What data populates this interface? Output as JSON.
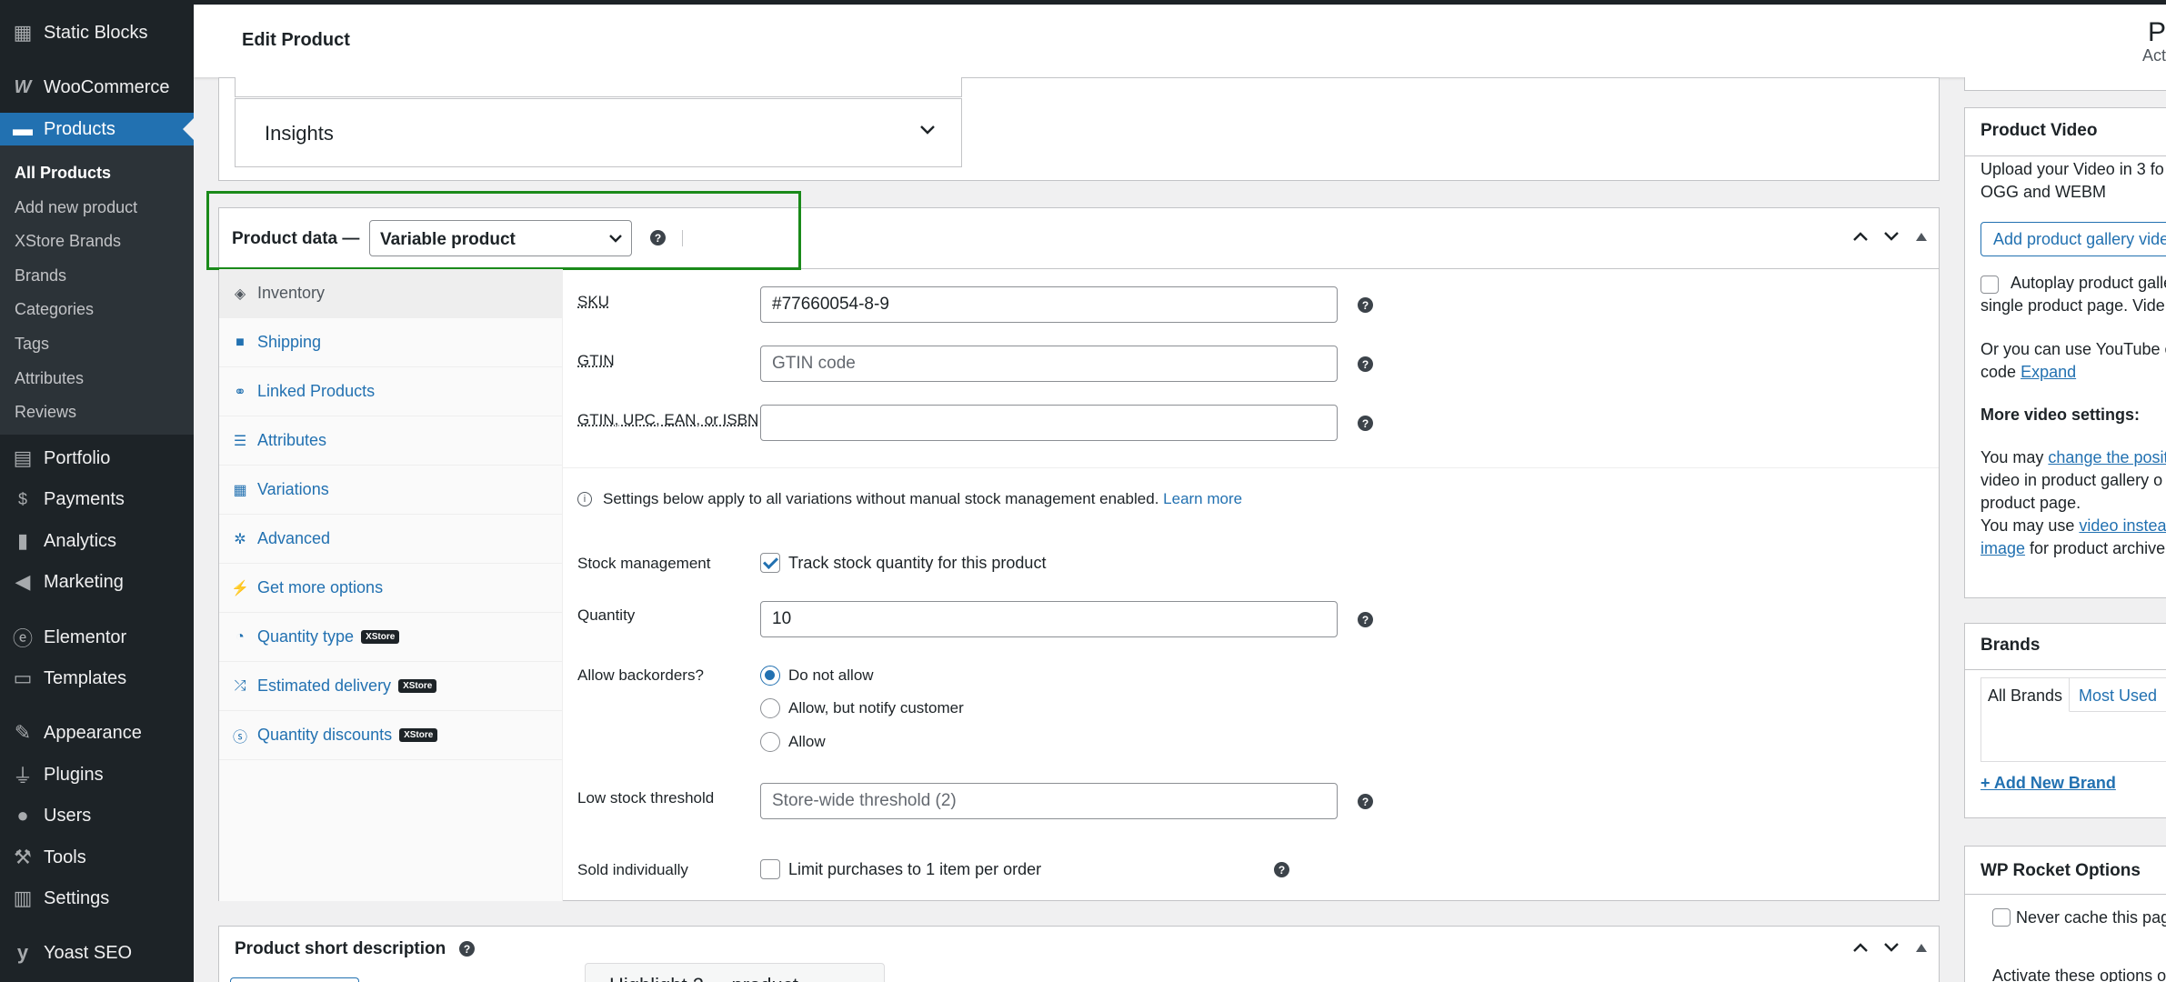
{
  "sidebar": {
    "items": [
      {
        "label": "Static Blocks",
        "icon": "grid-icon"
      },
      {
        "label": "WooCommerce",
        "icon": "woocommerce-icon"
      },
      {
        "label": "Products",
        "icon": "archive-icon"
      },
      {
        "label": "Portfolio",
        "icon": "portfolio-icon"
      },
      {
        "label": "Payments",
        "icon": "payments-icon"
      },
      {
        "label": "Analytics",
        "icon": "bar-chart-icon"
      },
      {
        "label": "Marketing",
        "icon": "megaphone-icon"
      },
      {
        "label": "Elementor",
        "icon": "elementor-icon"
      },
      {
        "label": "Templates",
        "icon": "folder-icon"
      },
      {
        "label": "Appearance",
        "icon": "brush-icon"
      },
      {
        "label": "Plugins",
        "icon": "plug-icon"
      },
      {
        "label": "Users",
        "icon": "user-icon"
      },
      {
        "label": "Tools",
        "icon": "wrench-icon"
      },
      {
        "label": "Settings",
        "icon": "sliders-icon"
      },
      {
        "label": "Yoast SEO",
        "icon": "yoast-icon"
      }
    ],
    "submenu": [
      "All Products",
      "Add new product",
      "XStore Brands",
      "Brands",
      "Categories",
      "Tags",
      "Attributes",
      "Reviews"
    ]
  },
  "header": {
    "title": "Edit Product",
    "right_top": "P",
    "right_bottom": "Act"
  },
  "insights": {
    "label": "Insights"
  },
  "product_data": {
    "label": "Product data —",
    "type_select": "Variable product",
    "tabs": [
      {
        "label": "Inventory",
        "icon": "tag-icon"
      },
      {
        "label": "Shipping",
        "icon": "truck-icon"
      },
      {
        "label": "Linked Products",
        "icon": "link-icon"
      },
      {
        "label": "Attributes",
        "icon": "list-icon"
      },
      {
        "label": "Variations",
        "icon": "grid-icon"
      },
      {
        "label": "Advanced",
        "icon": "gear-icon"
      },
      {
        "label": "Get more options",
        "icon": "plug-icon"
      },
      {
        "label": "Quantity type",
        "icon": "pie-icon",
        "badge": "XStore"
      },
      {
        "label": "Estimated delivery",
        "icon": "shuffle-icon",
        "badge": "XStore"
      },
      {
        "label": "Quantity discounts",
        "icon": "dollar-icon",
        "badge": "XStore"
      }
    ],
    "sku": {
      "label": "SKU",
      "value": "#77660054-8-9"
    },
    "gtin": {
      "label": "GTIN",
      "placeholder": "GTIN code"
    },
    "gtin_upc": {
      "label": "GTIN, UPC, EAN, or ISBN",
      "value": ""
    },
    "notice": {
      "text": "Settings below apply to all variations without manual stock management enabled.",
      "link": "Learn more"
    },
    "stock_management": {
      "label": "Stock management",
      "checkbox_label": "Track stock quantity for this product",
      "checked": true
    },
    "quantity": {
      "label": "Quantity",
      "value": "10"
    },
    "backorders": {
      "label": "Allow backorders?",
      "options": [
        "Do not allow",
        "Allow, but notify customer",
        "Allow"
      ],
      "selected": "Do not allow"
    },
    "low_stock": {
      "label": "Low stock threshold",
      "placeholder": "Store-wide threshold (2)"
    },
    "sold_individually": {
      "label": "Sold individually",
      "checkbox_label": "Limit purchases to 1 item per order",
      "checked": false
    }
  },
  "short_description": {
    "label": "Product short description",
    "tooltip_partial": "Highlight 2 ... product"
  },
  "product_video": {
    "title": "Product Video",
    "intro": "Upload your Video in 3 fo",
    "intro2": "OGG and WEBM",
    "button": "Add product gallery vide",
    "autoplay": "Autoplay product galle",
    "autoplay2": "single product page. Vide",
    "youtube": "Or you can use YouTube o",
    "youtube2": "code",
    "expand": "Expand",
    "more_settings": "More video settings:",
    "may1": "You may",
    "change_link": "change the posit",
    "may1b": "video in product gallery o",
    "may1c": "product page.",
    "may2": "You may use",
    "video_link": "video instea",
    "image_link": "image",
    "may2b": "for product archive"
  },
  "brands": {
    "title": "Brands",
    "tab_all": "All Brands",
    "tab_most": "Most Used",
    "add_link": "+ Add New Brand"
  },
  "wp_rocket": {
    "title": "WP Rocket Options",
    "never_cache": "Never cache this pag",
    "activate": "Activate these options o"
  },
  "colors": {
    "accent": "#2271b1",
    "sidebar": "#1d2327",
    "highlight_box": "#1a8a1a"
  }
}
